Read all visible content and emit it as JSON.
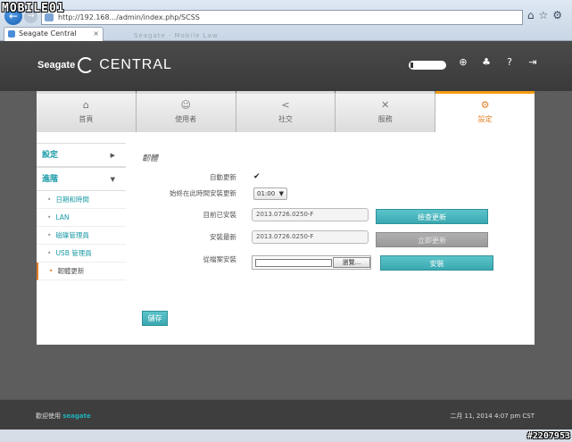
{
  "browser": {
    "address": "http://192.168.../admin/index.php/SCSS",
    "tab_title": "Seagate Central",
    "tab_close": "×",
    "ghost_tabs": "Seagate    ·    Mobile Law"
  },
  "header": {
    "logo_word": "Seagate",
    "product": "CENTRAL"
  },
  "nav": {
    "tabs": [
      {
        "label": "首頁",
        "icon": "home-icon"
      },
      {
        "label": "使用者",
        "icon": "user-icon"
      },
      {
        "label": "社交",
        "icon": "share-icon"
      },
      {
        "label": "服務",
        "icon": "tools-icon"
      },
      {
        "label": "設定",
        "icon": "gears-icon"
      }
    ],
    "active": 4
  },
  "sidebar": {
    "settings_label": "設定",
    "advanced_label": "進階",
    "items": [
      "日期和時間",
      "LAN",
      "磁碟管理員",
      "USB 管理員",
      "韌體更新"
    ]
  },
  "form": {
    "section_title": "韌體",
    "auto_update_label": "自動更新",
    "auto_update_checked": "✔",
    "install_time_label": "始終在此時間安裝更新",
    "install_time_value": "01:00",
    "installed_label": "目前已安裝",
    "installed_value": "2013.0726.0250-F",
    "check_update_button": "檢查更新",
    "latest_label": "安裝最新",
    "latest_value": "2013.0726.0250-F",
    "install_update_button": "立即更新",
    "from_file_label": "從檔案安裝",
    "browse_button": "瀏覽...",
    "install_button": "安裝",
    "save_button": "儲存"
  },
  "footer": {
    "welcome_prefix": "歡迎使用",
    "welcome_brand": "seagate",
    "datetime": "二月 11, 2014 4:07 pm CST"
  },
  "watermarks": {
    "top": "MOBILE01",
    "bottom": "#2207953"
  }
}
